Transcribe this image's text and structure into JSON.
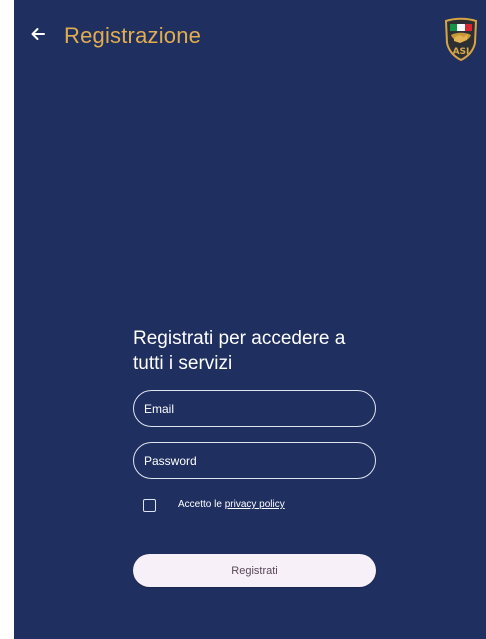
{
  "header": {
    "back_icon": "arrow-left-icon",
    "title": "Registrazione",
    "logo": "asi-shield-logo",
    "logo_text": "ASI"
  },
  "form": {
    "heading": "Registrati per accedere a tutti i servizi",
    "email_placeholder": "Email",
    "password_placeholder": "Password",
    "privacy_prefix": "Accetto le",
    "privacy_link": "privacy policy",
    "register_label": "Registrati"
  },
  "colors": {
    "background": "#1f2f5f",
    "title": "#e2ad4f",
    "text": "#ffffff",
    "button": "#f7f0f8",
    "button_text": "#59465a"
  }
}
